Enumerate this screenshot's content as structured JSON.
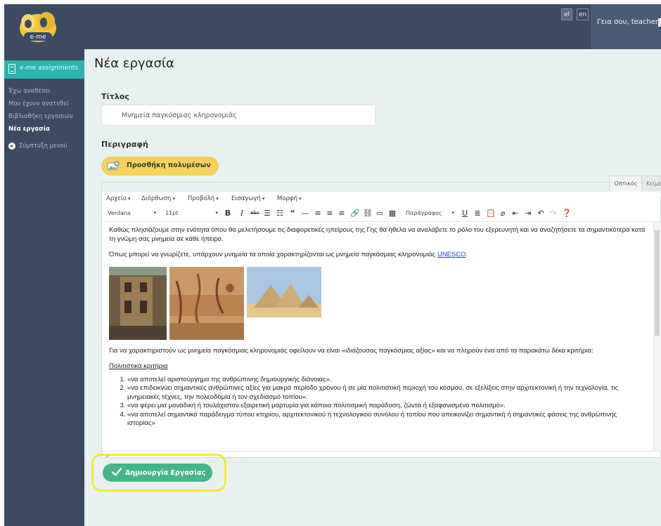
{
  "header": {
    "logo_text": "e-me",
    "lang_buttons": [
      "el",
      "en"
    ],
    "greeting": "Γεια σου, teacheriop"
  },
  "sidebar": {
    "app_label": "e-me assignments",
    "items": [
      {
        "label": "Έχω αναθέσει"
      },
      {
        "label": "Μου έχουν ανατεθεί"
      },
      {
        "label": "Βιβλιοθήκη εργασιών"
      },
      {
        "label": "Νέα εργασία",
        "active": true
      }
    ],
    "collapse_label": "Σύμπτυξη μενού"
  },
  "main": {
    "page_title": "Νέα εργασία",
    "title_label": "Τίτλος",
    "title_value": "Μνημεία παγκόσμιας κληρονομιάς",
    "description_label": "Περιγραφή",
    "add_media_label": "Προσθήκη πολυμέσων",
    "create_button_label": "Δημιουργία Εργασίας"
  },
  "editor": {
    "tabs": [
      "Οπτικός",
      "Κείμενο"
    ],
    "menus": [
      "Αρχείο",
      "Διόρθωση",
      "Προβολή",
      "Εισαγωγή",
      "Μορφή"
    ],
    "font_family": "Verdana",
    "font_size": "11pt",
    "block_format": "Παράγραφος",
    "paragraph1": "Καθώς πλησιάζουμε στην ενότητα όπου θα μελετήσουμε τις διαφορετικές ηπείρους της Γης θα ήθελα να αναλάβετε το ρόλο του εξερευνητή και να αναζητήσετε τα σημαντικότερα κατά τη γνώμη σας μνημεία σε κάθε ήπειρο.",
    "paragraph2_text": "Όπως μπορεί να γνωρίζετε, υπάρχουν μνημεία τα οποία χαρακτηρίζονται ως μνημεία παγκόσμιας κληρονομιάς",
    "paragraph2_link": "UNESCO",
    "paragraph3": "Για να χαρακτηριστούν ως μνημεία παγκόσμιας κληρονομιάς οφείλουν να είναι «ιδιάζουσας παγκόσμιας αξίας» και να πληρούν ένα από τα παρακάτω δέκα κριτήρια:",
    "criteria_heading": "Πολιτιστικά κριτήρια",
    "criteria": [
      "«να αποτελεί αριστούργημα της ανθρώπινης δημιουργικής διάνοιας».",
      "«να επιδεικνύει σημαντικές ανθρώπινες αξίες για μακρά περίοδο χρόνου ή σε μία πολιτιστική περιοχή του κόσμου, σε εξελίξεις στην αρχιτεκτονική ή την τεχνολογία, τις μνημειακές τέχνες, την πολεοδομία ή τον σχεδιασμό τοπίου».",
      "«να φέρει μια μοναδική ή τουλάχιστον εξαιρετική μαρτυρία για κάποια πολιτισμική παράδοση, ζώντα ή εξαφανισμένο πολιτισμό».",
      "«να αποτελεί σημαντικό παράδειγμα τύπου κτηρίου, αρχιτεκτονικού ή τεχνολογικού συνόλου ή τοπίου που απεικονίζει σημαντική ή σημαντικές φάσεις της ανθρώπινης ιστορίας»"
    ],
    "status_path": "p"
  },
  "colors": {
    "topbar": "#3c4b63",
    "accent_teal": "#29b5b1",
    "media_button": "#f6d15c",
    "create_button": "#46b58a",
    "highlight": "#f2ec2c",
    "main_bg": "#e8f1ef"
  },
  "icons": {
    "sidebar_app": "clipboard-icon",
    "collapse": "chevron-left-circle-icon",
    "media": "photo-plus-icon",
    "create": "check-icon"
  }
}
